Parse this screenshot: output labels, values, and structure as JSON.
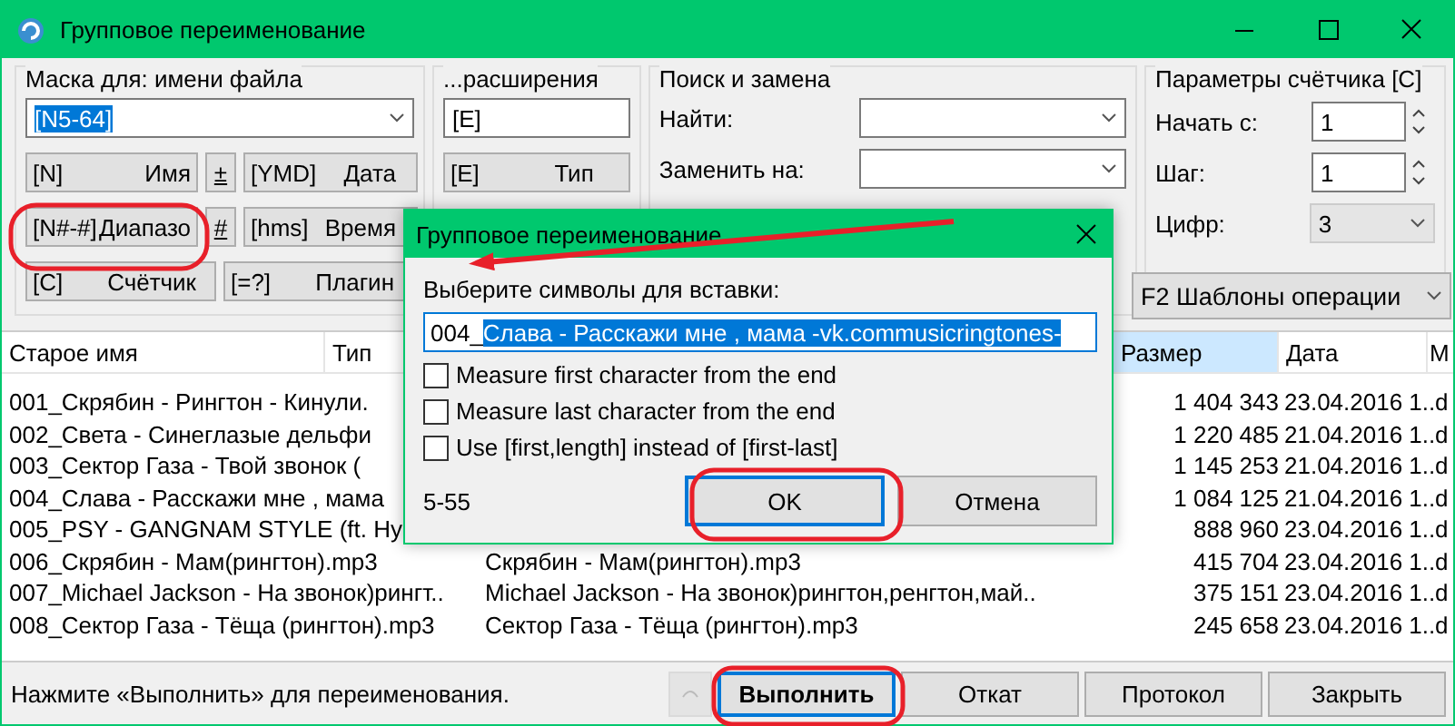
{
  "window": {
    "title": "Групповое переименование"
  },
  "mask": {
    "title": "Маска для: имени файла",
    "value": "[N5-64]",
    "selected": true,
    "buttons": [
      {
        "kind": "wide",
        "code": "[N]",
        "label": "Имя"
      },
      {
        "kind": "small",
        "code": "±"
      },
      {
        "kind": "wide",
        "code": "[YMD]",
        "label": "Дата"
      },
      {
        "kind": "wide",
        "code": "[N#-#]",
        "label": "Диапазо"
      },
      {
        "kind": "small",
        "code": "#"
      },
      {
        "kind": "wide",
        "code": "[hms]",
        "label": "Время"
      },
      {
        "kind": "half",
        "code": "[C]",
        "label": "Счётчик"
      },
      {
        "kind": "half",
        "code": "[=?]",
        "label": "Плагин"
      }
    ]
  },
  "extension": {
    "title": "...расширения",
    "value": "[E]",
    "button": {
      "code": "[E]",
      "label": "Тип"
    }
  },
  "search_replace": {
    "title": "Поиск и замена",
    "find_label": "Найти:",
    "replace_label": "Заменить на:"
  },
  "counter": {
    "title": "Параметры счётчика [C]",
    "start_label": "Начать с:",
    "start": "1",
    "step_label": "Шаг:",
    "step": "1",
    "digits_label": "Цифр:",
    "digits": "3"
  },
  "templates": {
    "label": "F2 Шаблоны операции"
  },
  "table": {
    "columns": [
      {
        "label": "Старое имя",
        "selected": false
      },
      {
        "label": "Тип",
        "selected": false
      },
      {
        "label": "Размер",
        "selected": true
      },
      {
        "label": "Дата",
        "selected": false
      },
      {
        "label": "М",
        "selected": false
      }
    ],
    "rows": [
      {
        "old_name": "001_Скрябин - Рингтон - Кинули.",
        "size": "1 404 343",
        "date": "23.04.2016 1..",
        "column_5": "d"
      },
      {
        "old_name": "002_Света - Синеглазые дельфи",
        "size": "1 220 485",
        "date": "21.04.2016 1..",
        "column_5": "d"
      },
      {
        "old_name": "003_Сектор Газа - Твой звонок (",
        "size": "1 145 253",
        "date": "21.04.2016 1..",
        "column_5": "d"
      },
      {
        "old_name": "004_Слава - Расскажи мне , мама",
        "size": "1 084 125",
        "date": "21.04.2016 1..",
        "column_5": "d"
      },
      {
        "old_name": "005_PSY - GANGNAM STYLE (ft. Hy",
        "size": "888 960",
        "date": "23.04.2016 1..",
        "column_5": "d"
      },
      {
        "old_name": "006_Скрябин - Мам(рингтон).mp3",
        "new_name": "Скрябин - Мам(рингтон).mp3",
        "size": "415 704",
        "date": "23.04.2016 1..",
        "column_5": "d"
      },
      {
        "old_name": "007_Michael Jackson - На звонок)рингт..",
        "new_name": "Michael Jackson - На звонок)рингтон,ренгтон,май..",
        "size": "375 151",
        "date": "23.04.2016 1..",
        "column_5": "d"
      },
      {
        "old_name": "008_Сектор Газа - Тёща (рингтон).mp3",
        "new_name": "Сектор Газа - Тёща (рингтон).mp3",
        "size": "245 658",
        "date": "23.04.2016 1..",
        "column_5": "d"
      }
    ]
  },
  "status_bar": {
    "text": "Нажмите «Выполнить» для переименования.",
    "undo_disabled": true
  },
  "buttons": [
    {
      "label": "Выполнить",
      "default": true
    },
    {
      "label": "Откат",
      "default": false
    },
    {
      "label": "Протокол",
      "default": false
    },
    {
      "label": "Закрыть",
      "default": false
    }
  ],
  "dialog": {
    "title": "Групповое переименование",
    "prompt": "Выберите символы для вставки:",
    "prefix": "004_",
    "selection": "Слава - Расскажи мне , мама -vk.commusicringtones-",
    "options": [
      {
        "label": "Measure first character from the end",
        "checked": false
      },
      {
        "label": "Measure last character from the end",
        "checked": false
      },
      {
        "label": "Use [first,length] instead of [first-last]",
        "checked": false
      }
    ],
    "range": "5-55",
    "buttons": [
      {
        "label": "OK",
        "default": true
      },
      {
        "label": "Отмена",
        "default": false
      }
    ]
  }
}
